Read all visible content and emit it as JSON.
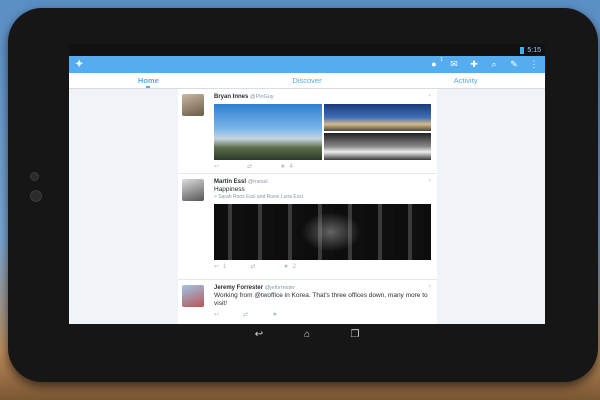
{
  "status": {
    "time": "5:15"
  },
  "topbar": {
    "notifications_count": "1",
    "icons": [
      "twitter-bird-icon",
      "notifications-icon",
      "messages-icon",
      "add-user-icon",
      "search-icon",
      "compose-icon",
      "overflow-menu-icon"
    ]
  },
  "tabs": [
    {
      "label": "Home",
      "active": true
    },
    {
      "label": "Discover",
      "active": false
    },
    {
      "label": "Activity",
      "active": false
    }
  ],
  "tweets": [
    {
      "name": "Bryan Innes",
      "handle": "@PinGuy",
      "text": "",
      "context": "",
      "reply": "",
      "retweets": "",
      "favorites": "4"
    },
    {
      "name": "Martin Essl",
      "handle": "@messl",
      "text": "Happiness",
      "context": "> Sarah Roos Essl and Rosie Luna Essl",
      "reply": "1",
      "retweets": "",
      "favorites": "2"
    },
    {
      "name": "Jeremy Forrester",
      "handle": "@jeforrester",
      "text": "Working from @twoffice in Korea. That's three offices down, many more to visit!",
      "context": "",
      "reply": "",
      "retweets": "",
      "favorites": ""
    }
  ],
  "colors": {
    "brand": "#55acee",
    "bezel": "#161616"
  }
}
